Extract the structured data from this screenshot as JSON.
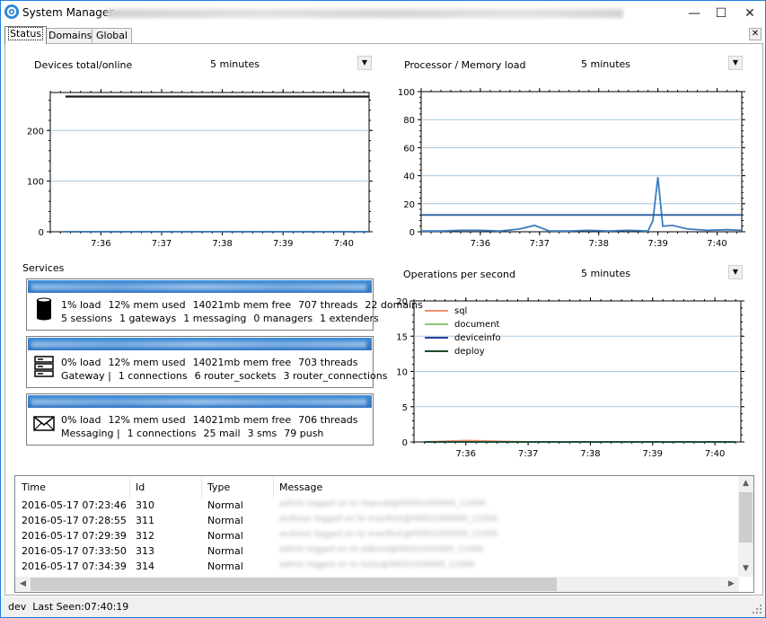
{
  "window": {
    "title": "System Manager -",
    "title_obscured": "Version 6.1.1.0 - Net 465 - Server 213.118.196.193 443 (SSL) - License Development Kit - 5/6/2016 - 5/8/Process"
  },
  "controls": {
    "minimize": "—",
    "maximize": "☐",
    "close": "✕"
  },
  "tabs": [
    {
      "label": "Status",
      "active": true
    },
    {
      "label": "Domains",
      "active": false
    },
    {
      "label": "Global",
      "active": false
    }
  ],
  "charts": {
    "devices": {
      "title": "Devices total/online",
      "range": "5 minutes"
    },
    "processor": {
      "title": "Processor / Memory load",
      "range": "5 minutes"
    },
    "ops": {
      "title": "Operations per second",
      "range": "5 minutes"
    }
  },
  "chart_data": [
    {
      "type": "line",
      "title": "Devices total/online",
      "x": [
        "7:35:25",
        "7:36:00",
        "7:37:00",
        "7:38:00",
        "7:39:00",
        "7:40:00",
        "7:40:25"
      ],
      "xticks": [
        "7:36",
        "7:37",
        "7:38",
        "7:39",
        "7:40"
      ],
      "ylim": [
        0,
        275
      ],
      "yticks": [
        0,
        100,
        200
      ],
      "series": [
        {
          "values": [
            267,
            267,
            267,
            267,
            267,
            267,
            267
          ],
          "color": "#1a1a1a"
        },
        {
          "values": [
            0,
            0,
            0,
            0,
            0,
            0,
            0
          ],
          "color": "#2e6da4"
        }
      ]
    },
    {
      "type": "line",
      "title": "Processor / Memory load",
      "x": [
        "7:35:00",
        "7:35:20",
        "7:35:40",
        "7:36:00",
        "7:36:20",
        "7:36:40",
        "7:36:55",
        "7:37:10",
        "7:37:30",
        "7:37:50",
        "7:38:10",
        "7:38:30",
        "7:38:50",
        "7:38:55",
        "7:39:00",
        "7:39:05",
        "7:39:15",
        "7:39:30",
        "7:39:50",
        "7:40:10",
        "7:40:25"
      ],
      "xticks": [
        "7:36",
        "7:37",
        "7:38",
        "7:39",
        "7:40"
      ],
      "ylim": [
        0,
        100
      ],
      "yticks": [
        0,
        20,
        40,
        60,
        80,
        100
      ],
      "series": [
        {
          "values": [
            0.5,
            0.5,
            1,
            1,
            0.5,
            2,
            4.5,
            0.5,
            0.5,
            1,
            0.5,
            1,
            0.5,
            8,
            39,
            4,
            4.5,
            2,
            1,
            1.5,
            1
          ],
          "color": "#3a7dbf"
        },
        {
          "values": [
            12,
            12,
            12,
            12,
            12,
            12,
            12,
            12,
            12,
            12,
            12,
            12,
            12,
            12,
            12,
            12,
            12,
            12,
            12,
            12,
            12
          ],
          "color": "#2a5f9e"
        }
      ]
    },
    {
      "type": "line",
      "title": "Operations per second",
      "x": [
        "7:35:20",
        "7:36:00",
        "7:37:00",
        "7:38:00",
        "7:39:00",
        "7:40:00",
        "7:40:20"
      ],
      "xticks": [
        "7:36",
        "7:37",
        "7:38",
        "7:39",
        "7:40"
      ],
      "ylim": [
        0,
        20
      ],
      "yticks": [
        0,
        5,
        10,
        15,
        20
      ],
      "legend": "top-left",
      "series": [
        {
          "name": "sql",
          "values": [
            0,
            0.2,
            0,
            0,
            0,
            0,
            0
          ],
          "color": "#f0906c"
        },
        {
          "name": "document",
          "values": [
            0,
            0,
            0,
            0,
            0,
            0,
            0
          ],
          "color": "#88c878"
        },
        {
          "name": "deviceinfo",
          "values": [
            0,
            0,
            0,
            0,
            0,
            0,
            0
          ],
          "color": "#2c3f9c"
        },
        {
          "name": "deploy",
          "values": [
            0,
            0,
            0,
            0,
            0,
            0,
            0
          ],
          "color": "#1d4a2a"
        }
      ]
    }
  ],
  "services": {
    "title": "Services",
    "items": [
      {
        "icon": "database-icon",
        "line1": [
          "1% load",
          "12% mem used",
          "14021mb mem free",
          "707 threads",
          "22 domains"
        ],
        "line2": [
          "5 sessions",
          "1 gateways",
          "1 messaging",
          "0 managers",
          "1 extenders"
        ]
      },
      {
        "icon": "server-icon",
        "line1": [
          "0% load",
          "12% mem used",
          "14021mb mem free",
          "703 threads"
        ],
        "line2": [
          "Gateway |",
          "1 connections",
          "6 router_sockets",
          "3 router_connections"
        ]
      },
      {
        "icon": "envelope-icon",
        "line1": [
          "0% load",
          "12% mem used",
          "14021mb mem free",
          "706 threads"
        ],
        "line2": [
          "Messaging |",
          "1 connections",
          "25 mail",
          "3 sms",
          "79 push"
        ]
      }
    ]
  },
  "log": {
    "columns": [
      "Time",
      "Id",
      "Type",
      "Message"
    ],
    "rows": [
      {
        "time": "2016-05-17 07:23:46",
        "id": "310",
        "type": "Normal",
        "message": "admin logged on to manual@00001000000_11000"
      },
      {
        "time": "2016-05-17 07:28:55",
        "id": "311",
        "type": "Normal",
        "message": "andreas logged on to manifest@00001000000_11000"
      },
      {
        "time": "2016-05-17 07:29:39",
        "id": "312",
        "type": "Normal",
        "message": "andreas logged on to manifest@00001000000_11000"
      },
      {
        "time": "2016-05-17 07:33:50",
        "id": "313",
        "type": "Normal",
        "message": "admin logged on to adbord@00001000000_11000"
      },
      {
        "time": "2016-05-17 07:34:39",
        "id": "314",
        "type": "Normal",
        "message": "admin logged on to tests@00001000000_11000"
      }
    ]
  },
  "status": {
    "user": "dev",
    "last_seen": "Last Seen:07:40:19"
  }
}
